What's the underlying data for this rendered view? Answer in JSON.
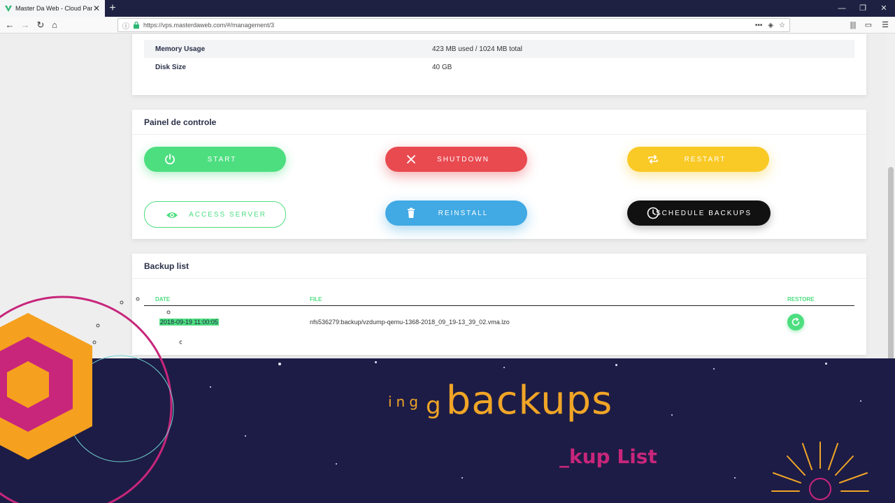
{
  "browser": {
    "tab_title": "Master Da Web - Cloud Panel",
    "url": "https://vps.masterdaweb.com/#/management/3"
  },
  "specs": {
    "memory_label": "Memory Usage",
    "memory_value": "423 MB used / 1024 MB total",
    "disk_label": "Disk Size",
    "disk_value": "40 GB"
  },
  "control_panel": {
    "title": "Painel de controle",
    "start": "START",
    "shutdown": "SHUTDOWN",
    "restart": "RESTART",
    "access": "ACCESS SERVER",
    "reinstall": "REINSTALL",
    "schedule": "SCHEDULE BACKUPS"
  },
  "backup_list": {
    "title": "Backup list",
    "headers": {
      "date": "DATE",
      "file": "FILE",
      "restore": "RESTORE"
    },
    "rows": [
      {
        "date": "2018-09-19 11:00:05",
        "file": "nfs536279:backup/vzdump-qemu-1368-2018_09_19-13_39_02.vma.lzo"
      }
    ]
  },
  "overlay": {
    "headline_small": "ing",
    "headline_g": "g",
    "headline_big": "backups",
    "subline": "_kup List"
  },
  "colors": {
    "green": "#4dde80",
    "red": "#e84a50",
    "yellow": "#f9c926",
    "blue": "#41a9e3",
    "banner": "#1d1c46",
    "orange": "#f0a526",
    "magenta": "#c7267b"
  }
}
